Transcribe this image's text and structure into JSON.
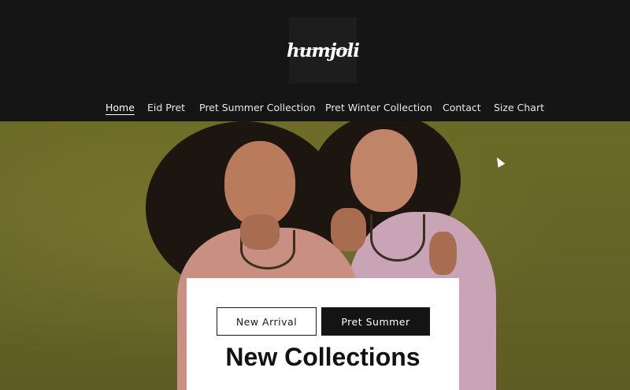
{
  "brand": {
    "logo_text": "humjoli"
  },
  "nav": {
    "items": [
      {
        "label": "Home",
        "active": true
      },
      {
        "label": "Eid Pret",
        "active": false
      },
      {
        "label": "Pret Summer Collection",
        "active": false
      },
      {
        "label": "Pret Winter Collection",
        "active": false
      },
      {
        "label": "Contact",
        "active": false
      },
      {
        "label": "Size Chart",
        "active": false
      }
    ]
  },
  "hero": {
    "new_arrival_label": "New Arrival",
    "pret_summer_label": "Pret Summer",
    "title": "New Collections"
  },
  "colors": {
    "header_bg": "#151515",
    "hero_bg": "#656326",
    "button_dark": "#141414"
  }
}
